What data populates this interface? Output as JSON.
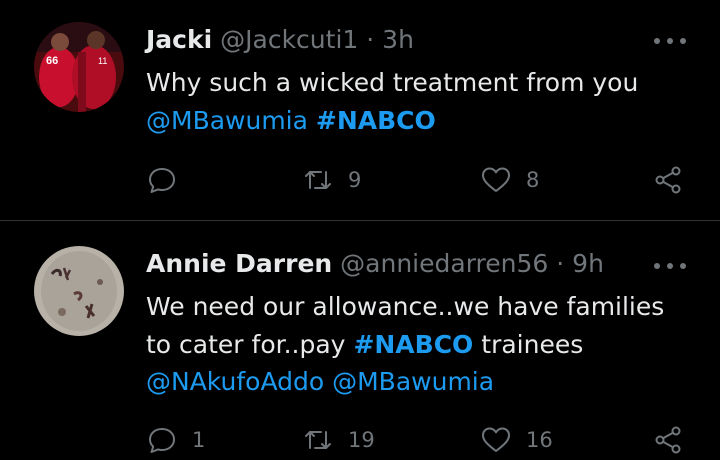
{
  "tweets": [
    {
      "name": "Jacki",
      "handle": "@Jackcuti1",
      "time_sep": "·",
      "time": "3h",
      "body": [
        {
          "type": "text",
          "value": "Why such a wicked treatment from you"
        },
        {
          "type": "mention",
          "value": "@MBawumia"
        },
        {
          "type": "hashtag",
          "value": "#NABCO"
        }
      ],
      "actions": {
        "replies": "",
        "retweets": "9",
        "likes": "8"
      }
    },
    {
      "name": "Annie Darren",
      "handle": "@anniedarren56",
      "time_sep": "·",
      "time": "9h",
      "body": [
        {
          "type": "text",
          "value": "We need our allowance..we have families to cater for..pay"
        },
        {
          "type": "hashtag",
          "value": "#NABCO"
        },
        {
          "type": "text",
          "value": "trainees"
        },
        {
          "type": "mention",
          "value": "@NAkufoAddo"
        },
        {
          "type": "mention",
          "value": "@MBawumia"
        }
      ],
      "actions": {
        "replies": "1",
        "retweets": "19",
        "likes": "16"
      }
    }
  ],
  "colors": {
    "background": "#000000",
    "text": "#e7e9ea",
    "muted": "#71767b",
    "accent": "#1d9bf0",
    "divider": "#2f3336"
  },
  "icons": {
    "reply": "speech-bubble",
    "retweet": "two-arrows-loop",
    "like": "heart-outline",
    "share": "share-nodes",
    "more": "three-dots"
  }
}
